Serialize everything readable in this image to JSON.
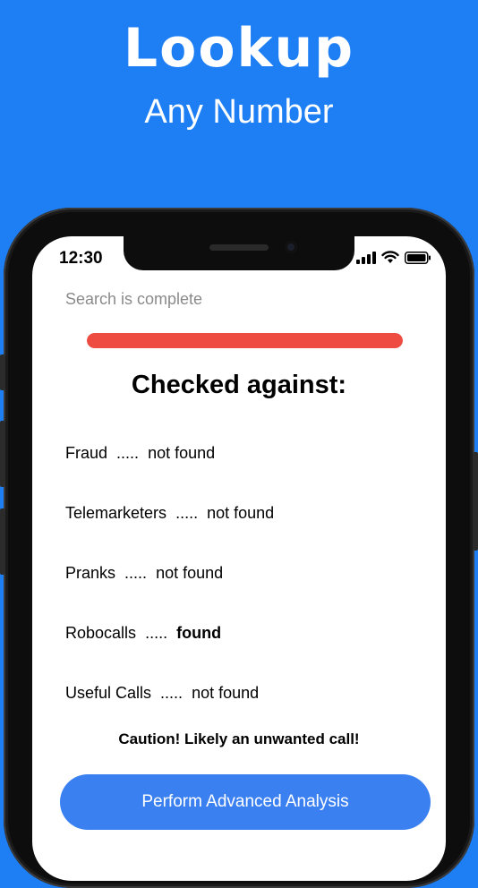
{
  "promo": {
    "title": "Lookup",
    "subtitle": "Any Number"
  },
  "status_bar": {
    "time": "12:30",
    "icons": [
      "cellular-signal-icon",
      "wifi-icon",
      "battery-icon"
    ]
  },
  "search": {
    "status_text": "Search is complete",
    "progress_fraction": 1.0
  },
  "checks": {
    "heading": "Checked against:",
    "separator": ".....",
    "items": [
      {
        "name": "Fraud",
        "result": "not found",
        "found": false
      },
      {
        "name": "Telemarketers",
        "result": "not found",
        "found": false
      },
      {
        "name": "Pranks",
        "result": "not found",
        "found": false
      },
      {
        "name": "Robocalls",
        "result": "found",
        "found": true
      },
      {
        "name": "Useful Calls",
        "result": "not found",
        "found": false
      }
    ]
  },
  "warning": {
    "text": "Caution! Likely an unwanted call!"
  },
  "actions": {
    "advanced_analysis_label": "Perform Advanced Analysis"
  },
  "colors": {
    "background": "#1e7ff5",
    "progress": "#ee4c40",
    "button": "#3a80f0"
  }
}
